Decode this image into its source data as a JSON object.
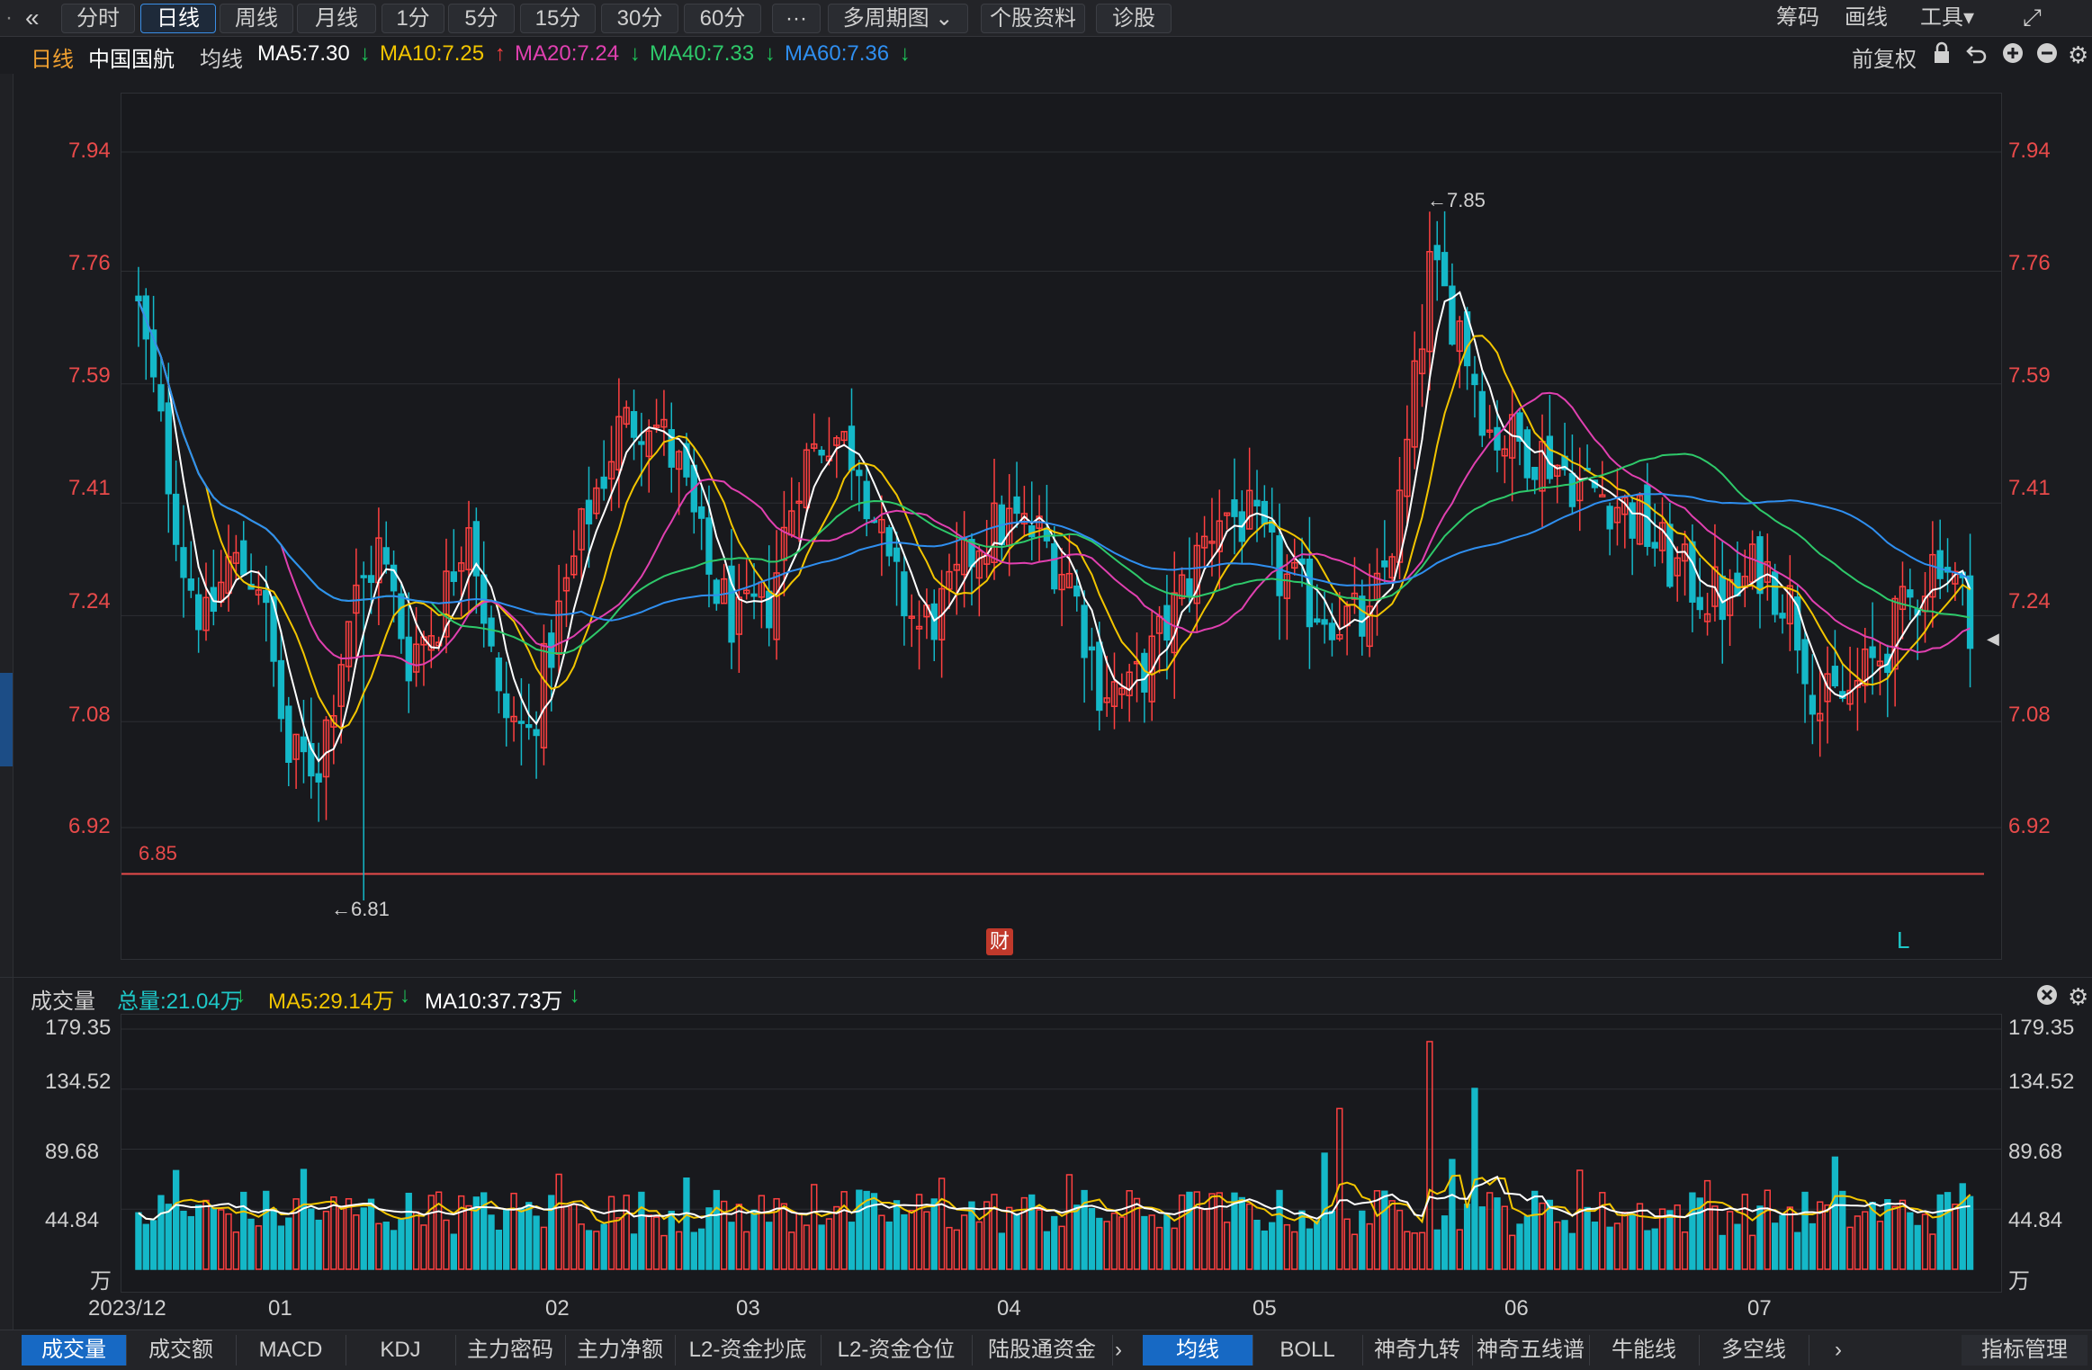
{
  "toolbar": {
    "back_icon": "double-chevron-left-icon",
    "tabs": [
      "分时",
      "日线",
      "周线",
      "月线",
      "1分",
      "5分",
      "15分",
      "30分",
      "60分",
      "···",
      "多周期图 ⌄",
      "个股资料",
      "诊股"
    ],
    "active_tab": "日线",
    "right": [
      "筹码",
      "画线",
      "工具▾"
    ],
    "expand_icon": "expand-icon"
  },
  "info": {
    "period": "日线",
    "stock": "中国国航",
    "ma_label": "均线",
    "ma": [
      {
        "text": "MA5:7.30",
        "arrow": "↓",
        "color": "#ffffff",
        "arrow_color": "#1ec75a"
      },
      {
        "text": "MA10:7.25",
        "arrow": "↑",
        "color": "#f2c500",
        "arrow_color": "#ff4040"
      },
      {
        "text": "MA20:7.24",
        "arrow": "↓",
        "color": "#e040b0",
        "arrow_color": "#1ec75a"
      },
      {
        "text": "MA40:7.33",
        "arrow": "↓",
        "color": "#2ec96a",
        "arrow_color": "#1ec75a"
      },
      {
        "text": "MA60:7.36",
        "arrow": "↓",
        "color": "#2f8ff0",
        "arrow_color": "#1ec75a"
      }
    ],
    "adjust": "前复权",
    "icons": [
      "lock-icon",
      "undo-icon",
      "zoom-in-icon",
      "zoom-out-icon",
      "gear-icon"
    ]
  },
  "price_axis": {
    "ticks": [
      "7.94",
      "7.76",
      "7.59",
      "7.41",
      "7.24",
      "7.08",
      "6.92"
    ]
  },
  "annotations": {
    "high": "←7.85",
    "low": "←6.81",
    "line_label": "6.85",
    "cai": "财",
    "l_mark": "L"
  },
  "volume_header": {
    "title": "成交量",
    "items": [
      {
        "text": "总量:21.04万",
        "arrow": "↓",
        "color": "#1ec8c8"
      },
      {
        "text": "MA5:29.14万",
        "arrow": "↓",
        "color": "#f2c500"
      },
      {
        "text": "MA10:37.73万",
        "arrow": "↓",
        "color": "#ffffff"
      }
    ]
  },
  "volume_axis": {
    "ticks": [
      "179.35",
      "134.52",
      "89.68",
      "44.84"
    ],
    "unit": "万"
  },
  "x_labels": [
    "2023/12",
    "01",
    "02",
    "03",
    "04",
    "05",
    "06",
    "07"
  ],
  "bottom_tabs_left": [
    "成交量",
    "成交额",
    "MACD",
    "KDJ",
    "主力密码",
    "主力净额",
    "L2-资金抄底",
    "L2-资金仓位",
    "陆股通资金"
  ],
  "bottom_tabs_right": [
    "均线",
    "BOLL",
    "神奇九转",
    "神奇五线谱",
    "牛能线",
    "多空线"
  ],
  "bottom_right": "指标管理",
  "colors": {
    "up": "#ff4040",
    "down": "#14b8c8",
    "ma5": "#ffffff",
    "ma10": "#f2c500",
    "ma20": "#e040b0",
    "ma40": "#2ec96a",
    "ma60": "#2f8ff0",
    "ref_line": "#e84a4a"
  },
  "chart_data": {
    "type": "candlestick",
    "title": "中国国航 日线",
    "x_range": [
      "2023/12",
      "07"
    ],
    "y_ticks": [
      6.92,
      7.08,
      7.24,
      7.41,
      7.59,
      7.76,
      7.94
    ],
    "reference_line": 6.85,
    "high_mark": 7.85,
    "low_mark": 6.81,
    "volume_unit": "万",
    "ma_last": {
      "MA5": 7.3,
      "MA10": 7.25,
      "MA20": 7.24,
      "MA40": 7.33,
      "MA60": 7.36
    },
    "volume_last": {
      "total": 21.04,
      "MA5": 29.14,
      "MA10": 37.73
    }
  }
}
